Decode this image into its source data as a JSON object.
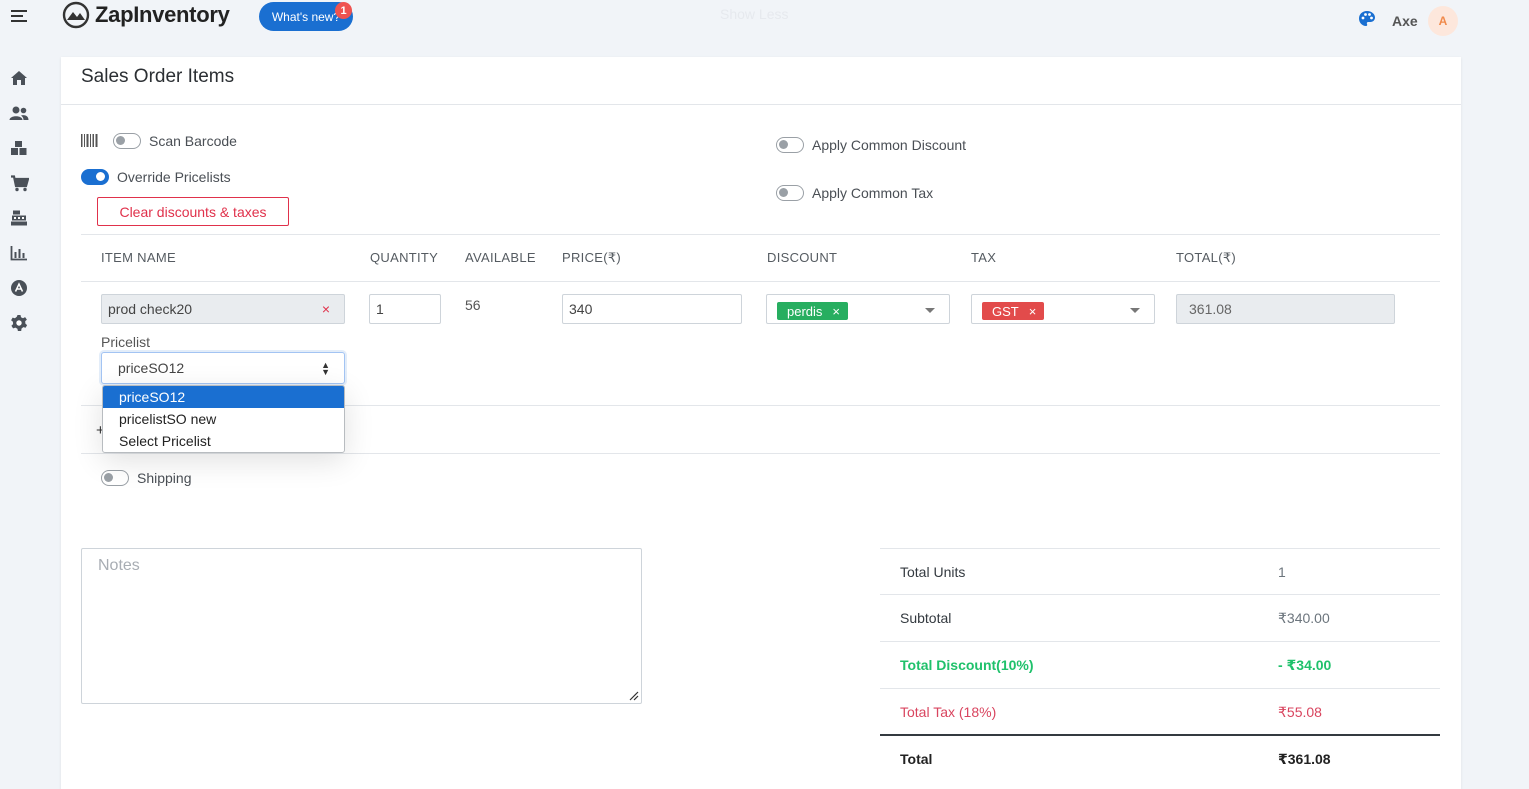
{
  "app": {
    "name": "ZapInventory",
    "whats_new_label": "What's new?",
    "whats_new_count": "1",
    "show_less": "Show Less"
  },
  "user": {
    "name": "Axe",
    "initial": "A"
  },
  "sidebar": {
    "icons": [
      "home-icon",
      "users-icon",
      "boxes-icon",
      "cart-icon",
      "cash-register-icon",
      "chart-icon",
      "app-store-icon",
      "gear-icon"
    ]
  },
  "section": {
    "title": "Sales Order Items"
  },
  "options": {
    "scan_barcode": {
      "label": "Scan Barcode",
      "on": false
    },
    "override_pricelists": {
      "label": "Override Pricelists",
      "on": true
    },
    "apply_common_discount": {
      "label": "Apply Common Discount",
      "on": false
    },
    "apply_common_tax": {
      "label": "Apply Common Tax",
      "on": false
    },
    "clear_button": "Clear discounts & taxes"
  },
  "table": {
    "headers": {
      "item": "ITEM NAME",
      "quantity": "QUANTITY",
      "available": "AVAILABLE",
      "price": "PRICE(₹)",
      "discount": "DISCOUNT",
      "tax": "TAX",
      "total": "TOTAL(₹)"
    },
    "row": {
      "item": "prod check20",
      "remove": "×",
      "quantity": "1",
      "available": "56",
      "price": "340",
      "discount_tag": "perdis",
      "tax_tag": "GST",
      "tag_remove": "×",
      "total": "361.08",
      "pricelist_label": "Pricelist",
      "pricelist_value": "priceSO12",
      "pricelist_options": [
        "priceSO12",
        "pricelistSO new",
        "Select Pricelist"
      ]
    },
    "add_symbol": "+"
  },
  "shipping": {
    "label": "Shipping",
    "on": false
  },
  "notes": {
    "placeholder": "Notes"
  },
  "summary": {
    "total_units": {
      "label": "Total Units",
      "value": "1"
    },
    "subtotal": {
      "label": "Subtotal",
      "value": "₹340.00"
    },
    "discount": {
      "label": "Total Discount(10%)",
      "value": "- ₹34.00"
    },
    "tax": {
      "label": "Total Tax (18%)",
      "value": "₹55.08"
    },
    "total": {
      "label": "Total",
      "value": "₹361.08"
    }
  },
  "colors": {
    "primary": "#1a6fd1",
    "danger": "#e0314b",
    "success": "#1fc16b",
    "tax_label": "#d9455f",
    "discount_tag": "#27ae60",
    "tax_tag": "#e24b4b"
  }
}
